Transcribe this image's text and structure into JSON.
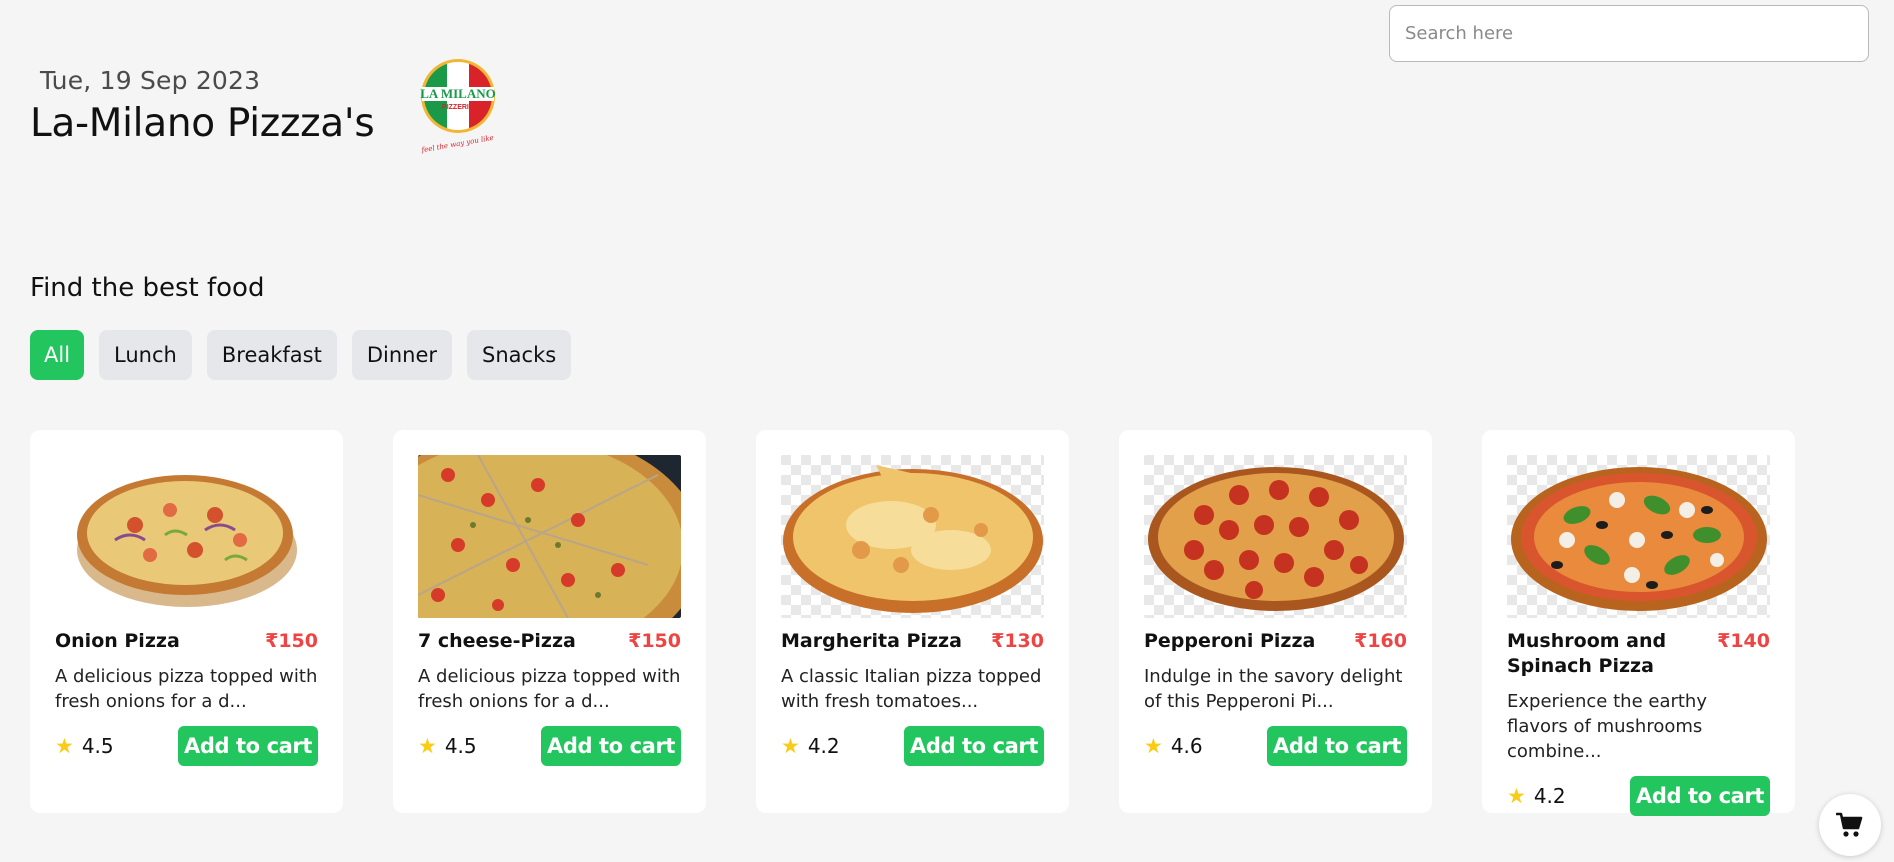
{
  "header": {
    "date": "Tue, 19 Sep 2023",
    "title": "La-Milano Pizzza's",
    "logo": {
      "brand": "LA MILANO",
      "sub": "PIZZERIA",
      "tagline": "feel the way you like"
    }
  },
  "search": {
    "placeholder": "Search here",
    "value": ""
  },
  "section_heading": "Find the best food",
  "categories": [
    {
      "label": "All",
      "active": true
    },
    {
      "label": "Lunch",
      "active": false
    },
    {
      "label": "Breakfast",
      "active": false
    },
    {
      "label": "Dinner",
      "active": false
    },
    {
      "label": "Snacks",
      "active": false
    }
  ],
  "products": [
    {
      "name": "Onion Pizza",
      "price": "₹150",
      "description": "A delicious pizza topped with fresh onions for a d...",
      "rating": "4.5",
      "cart_label": "Add to cart"
    },
    {
      "name": "7 cheese-Pizza",
      "price": "₹150",
      "description": "A delicious pizza topped with fresh onions for a d...",
      "rating": "4.5",
      "cart_label": "Add to cart"
    },
    {
      "name": "Margherita Pizza",
      "price": "₹130",
      "description": "A classic Italian pizza topped with fresh tomatoes...",
      "rating": "4.2",
      "cart_label": "Add to cart"
    },
    {
      "name": "Pepperoni Pizza",
      "price": "₹160",
      "description": "Indulge in the savory delight of this Pepperoni Pi...",
      "rating": "4.6",
      "cart_label": "Add to cart"
    },
    {
      "name": "Mushroom and Spinach Pizza",
      "price": "₹140",
      "description": "Experience the earthy flavors of mushrooms combine...",
      "rating": "4.2",
      "cart_label": "Add to cart"
    }
  ],
  "icons": {
    "rating": "star-icon",
    "cart": "shopping-cart-icon"
  },
  "colors": {
    "accent": "#22c55e",
    "price": "#ef4444",
    "star": "#facc15",
    "chip": "#e5e7eb",
    "background": "#f5f5f5"
  }
}
